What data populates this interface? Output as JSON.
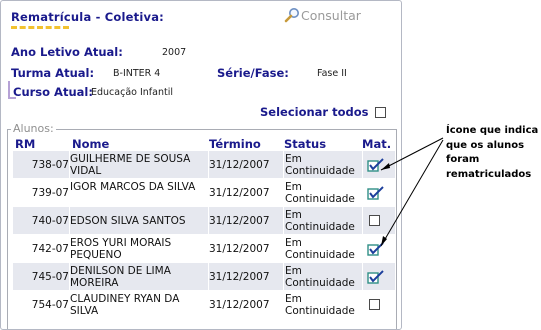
{
  "header": {
    "title": "Rematrícula - Coletiva:",
    "consultar_label": "Consultar"
  },
  "info": {
    "ano_letivo_label": "Ano Letivo Atual:",
    "ano_letivo_value": "2007",
    "turma_label": "Turma Atual:",
    "turma_value": "B-INTER 4",
    "serie_label": "Série/Fase:",
    "serie_value": "Fase II",
    "curso_label": "Curso Atual:",
    "curso_value": "Educação Infantil"
  },
  "select_all_label": "Selecionar todos",
  "alunos_legend": "Alunos:",
  "columns": [
    "RM",
    "Nome",
    "Término",
    "Status",
    "Mat."
  ],
  "rows": [
    {
      "rm": "738-07",
      "nome": "GUILHERME DE SOUSA VIDAL",
      "termino": "31/12/2007",
      "status": "Em Continuidade",
      "mat": true
    },
    {
      "rm": "739-07",
      "nome": "IGOR MARCOS DA SILVA",
      "termino": "31/12/2007",
      "status": "Em Continuidade",
      "mat": true
    },
    {
      "rm": "740-07",
      "nome": "EDSON SILVA SANTOS",
      "termino": "31/12/2007",
      "status": "Em Continuidade",
      "mat": false
    },
    {
      "rm": "742-07",
      "nome": "EROS YURI MORAIS PEQUENO",
      "termino": "31/12/2007",
      "status": "Em Continuidade",
      "mat": true
    },
    {
      "rm": "745-07",
      "nome": "DENILSON DE LIMA MOREIRA",
      "termino": "31/12/2007",
      "status": "Em Continuidade",
      "mat": true
    },
    {
      "rm": "754-07",
      "nome": "CLAUDINEY RYAN DA SILVA",
      "termino": "31/12/2007",
      "status": "Em Continuidade",
      "mat": false
    }
  ],
  "annotation": "Ícone que indica que os alunos foram rematriculados",
  "colors": {
    "label_blue": "#1a1a8c",
    "row_alt": "#e6e8ef",
    "underline_yellow": "#f2c230",
    "check_teal": "#2f8f86",
    "check_blue": "#1d3f9c"
  },
  "icons": {
    "consultar": "magnifier-icon",
    "matriculado": "checked-clipboard-icon",
    "nao_matriculado": "empty-checkbox"
  }
}
